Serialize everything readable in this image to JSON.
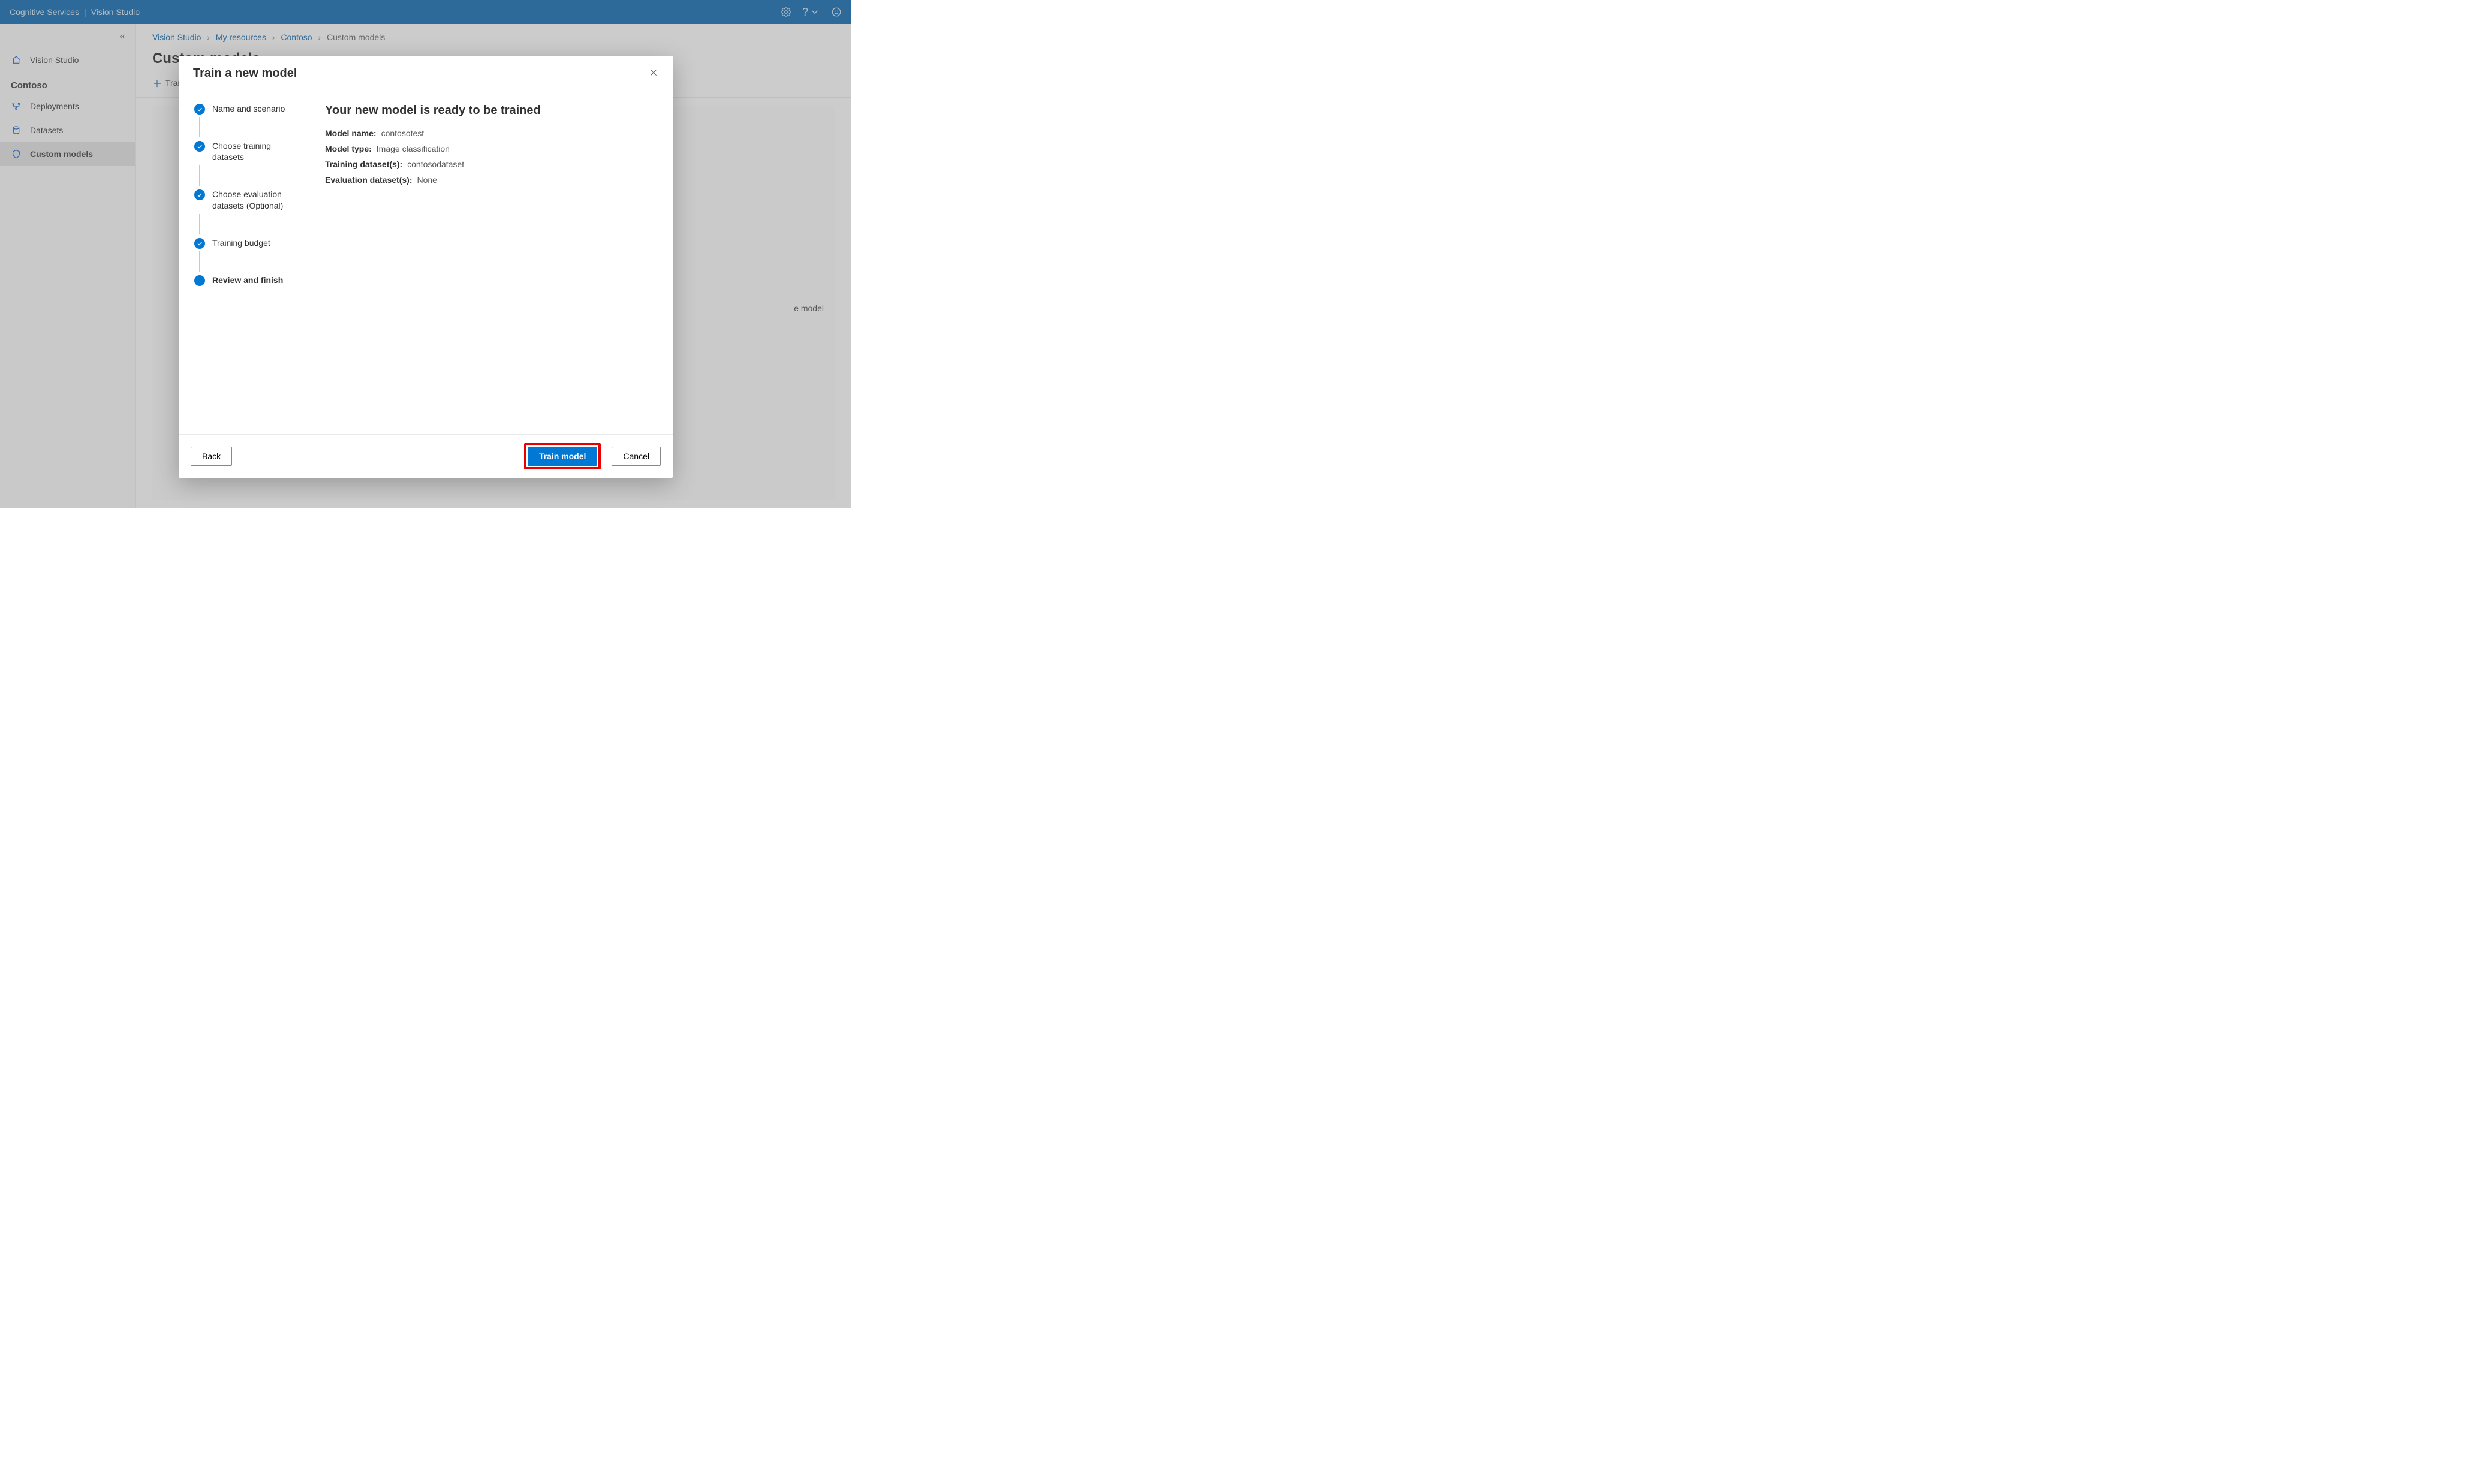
{
  "topbar": {
    "product": "Cognitive Services",
    "section": "Vision Studio"
  },
  "sidebar": {
    "home": "Vision Studio",
    "resource": "Contoso",
    "items": [
      {
        "label": "Deployments"
      },
      {
        "label": "Datasets"
      },
      {
        "label": "Custom models"
      }
    ]
  },
  "breadcrumb": {
    "a": "Vision Studio",
    "b": "My resources",
    "c": "Contoso",
    "d": "Custom models"
  },
  "page": {
    "title": "Custom models",
    "train_action": "Train a new model"
  },
  "peek_text": "e model",
  "dialog": {
    "title": "Train a new model",
    "steps": [
      "Name and scenario",
      "Choose training datasets",
      "Choose evaluation datasets (Optional)",
      "Training budget",
      "Review and finish"
    ],
    "review": {
      "title": "Your new model is ready to be trained",
      "rows": [
        {
          "k": "Model name:",
          "v": "contosotest"
        },
        {
          "k": "Model type:",
          "v": "Image classification"
        },
        {
          "k": "Training dataset(s):",
          "v": "contosodataset"
        },
        {
          "k": "Evaluation dataset(s):",
          "v": "None"
        }
      ]
    },
    "buttons": {
      "back": "Back",
      "train": "Train model",
      "cancel": "Cancel"
    }
  }
}
